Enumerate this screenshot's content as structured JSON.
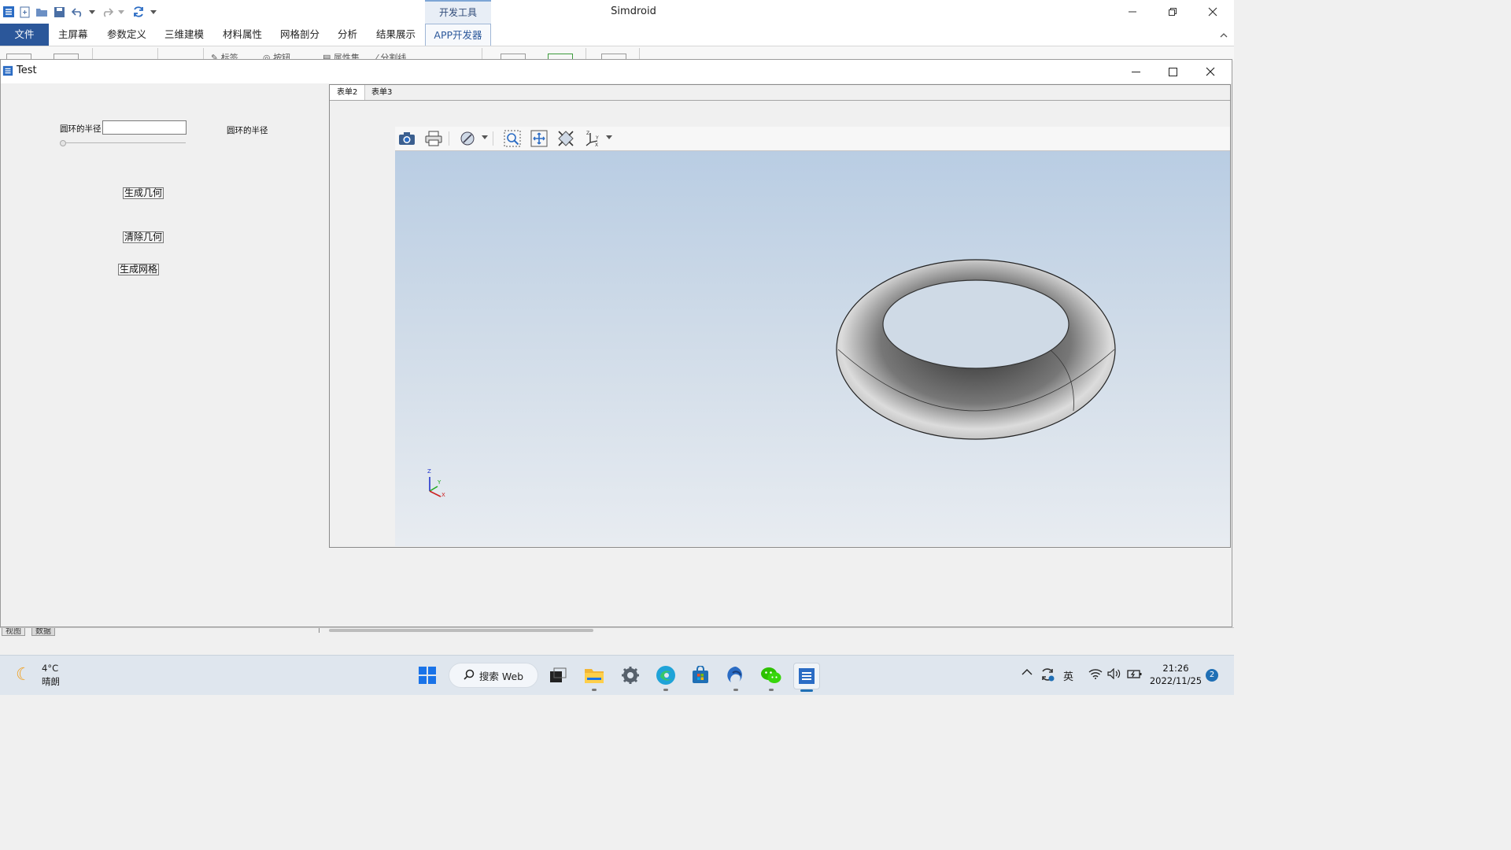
{
  "app": {
    "title": "Simdroid",
    "context_tab": "开发工具",
    "menu": [
      "文件",
      "主屏幕",
      "参数定义",
      "三维建模",
      "材料属性",
      "网格剖分",
      "分析",
      "结果展示",
      "APP开发器"
    ],
    "ribbon_partial": [
      "标签",
      "按钮",
      "属性集",
      "分割线"
    ]
  },
  "dialog": {
    "title": "Test",
    "radius_label": "圆环的半径",
    "radius_value": "",
    "radius_label_2": "圆环的半径",
    "buttons": {
      "generate_geometry": "生成几何",
      "clear_geometry": "清除几何",
      "generate_mesh": "生成网格"
    },
    "tabs": [
      "表单2",
      "表单3"
    ],
    "viewer": {
      "axes": {
        "z": "Z",
        "y": "Y",
        "x": "X"
      }
    }
  },
  "statusbar": {
    "tabs": [
      "视图",
      "数据"
    ]
  },
  "taskbar": {
    "weather": {
      "temp": "4°C",
      "condition": "晴朗"
    },
    "search_label": "搜索 Web",
    "ime": "英",
    "time": "21:26",
    "date": "2022/11/25",
    "notifications": "2"
  },
  "colors": {
    "accent": "#2b579a",
    "viewport_top": "#b9cde3",
    "viewport_bottom": "#e8ecf1"
  }
}
